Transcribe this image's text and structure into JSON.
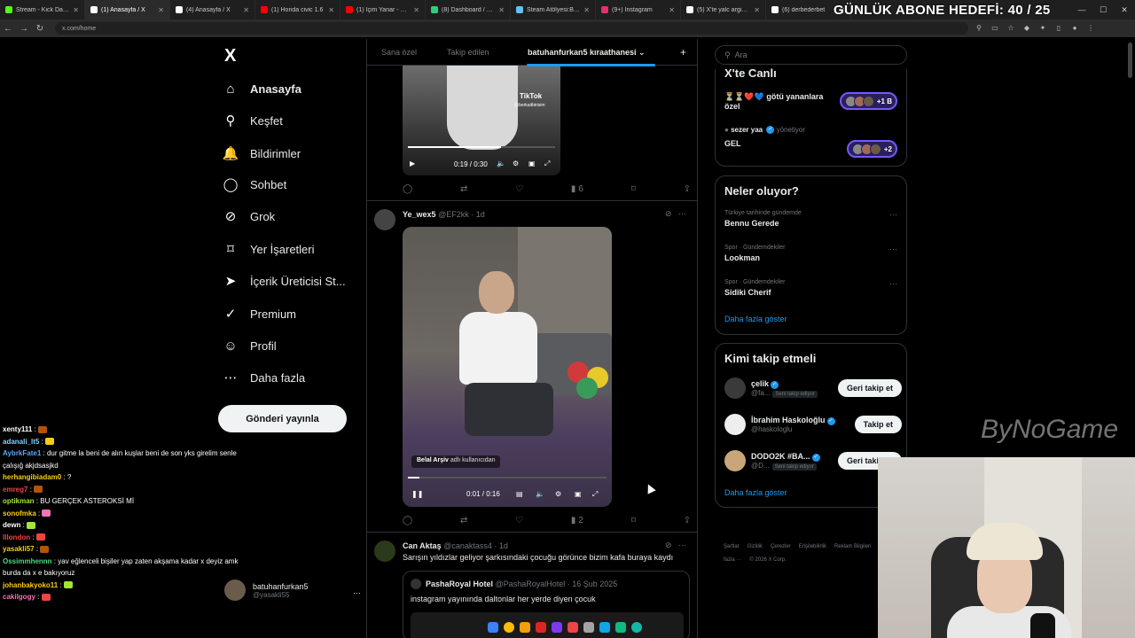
{
  "browser": {
    "tabs": [
      {
        "label": "Stream - Kick Dashboard",
        "color": "#53fc18"
      },
      {
        "label": "(1) Anasayfa / X",
        "color": "#ffffff"
      },
      {
        "label": "(4) Anasayfa / X",
        "color": "#ffffff"
      },
      {
        "label": "(1) Honda civic 1.6",
        "color": "#ff0000"
      },
      {
        "label": "(1) İçim Yanar - Şahin K",
        "color": "#ff0000"
      },
      {
        "label": "(8) Dashboard / Stream",
        "color": "#2ad17a"
      },
      {
        "label": "Steam Atölyesi:Batuha",
        "color": "#66c0f4"
      },
      {
        "label": "(9+) Instagram",
        "color": "#e1306c"
      },
      {
        "label": "(5) X'te yalc argisi \"de",
        "color": "#ffffff"
      },
      {
        "label": "(6) derbederbet",
        "color": "#ffffff"
      }
    ],
    "url": "x.com/home",
    "overlay_goal": "GÜNLÜK ABONE HEDEFİ: 40 / 25"
  },
  "nav": {
    "logo": "X",
    "items": [
      {
        "label": "Anasayfa",
        "icon": "home-icon",
        "glyph": "⌂"
      },
      {
        "label": "Keşfet",
        "icon": "search-icon",
        "glyph": "⚲"
      },
      {
        "label": "Bildirimler",
        "icon": "bell-icon",
        "glyph": "🔔"
      },
      {
        "label": "Sohbet",
        "icon": "chat-bubble-icon",
        "glyph": "◯"
      },
      {
        "label": "Grok",
        "icon": "grok-icon",
        "glyph": "⊘"
      },
      {
        "label": "Yer İşaretleri",
        "icon": "bookmark-icon",
        "glyph": "⌑"
      },
      {
        "label": "İçerik Üreticisi St...",
        "icon": "rocket-icon",
        "glyph": "➤"
      },
      {
        "label": "Premium",
        "icon": "premium-check-icon",
        "glyph": "✓"
      },
      {
        "label": "Profil",
        "icon": "person-icon",
        "glyph": "☺"
      },
      {
        "label": "Daha fazla",
        "icon": "more-circle-icon",
        "glyph": "⋯"
      }
    ],
    "post_button": "Gönderi yayınla",
    "profile": {
      "name": "batuhanfurkan5",
      "handle": "@yasakli55",
      "more": "···"
    }
  },
  "feed": {
    "tabs": [
      "Sana özel",
      "Takip edilen",
      "batuhanfurkan5 kıraathanesi ⌄"
    ],
    "plus": "+",
    "post1": {
      "video_time": "0:19 / 0:30",
      "tiktok_label": "TikTok",
      "tiktok_handle": "@berkaitbirisim",
      "progress": 0.63,
      "views": "6"
    },
    "post2": {
      "name": "Ye_wex5",
      "handle": "@EF2kk",
      "time": "· 1d",
      "video_time": "0:01 / 0:16",
      "credit_name": "Belal Arşiv",
      "credit_suffix": "adlı kullanıcıdan",
      "progress": 0.06,
      "views": "2"
    },
    "post3": {
      "name": "Can Aktaş",
      "handle": "@canaktass4",
      "time": "· 1d",
      "text": "Sarışın yıldızlar geliyor şarkısındaki çocuğu görünce bizim kafa buraya kaydı",
      "quote": {
        "name": "PashaRoyal Hotel",
        "handle": "@PashaRoyalHotel",
        "time": "· 16 Şub 2025",
        "text": "instagram yayınında daltonlar her yerde diyen çocuk"
      }
    }
  },
  "right": {
    "search_placeholder": "Ara",
    "live": {
      "title": "X'te Canlı",
      "items": [
        {
          "title": "⏳⏳❤️💙 götü yananlara özel",
          "count": "+1 B"
        },
        {
          "host": "sezer yaa",
          "role": "yönetiyor",
          "title": "GEL",
          "count": "+2"
        }
      ]
    },
    "trends": {
      "title": "Neler oluyor?",
      "items": [
        {
          "context": "Türkiye tarihinde gündemde",
          "name": "Bennu Gerede"
        },
        {
          "context": "Spor · Gündemdekiler",
          "name": "Lookman"
        },
        {
          "context": "Spor · Gündemdekiler",
          "name": "Sidiki Cherif"
        }
      ],
      "more": "Daha fazla göster"
    },
    "follow": {
      "title": "Kimi takip etmeli",
      "items": [
        {
          "name": "çelik",
          "handle": "@fa...",
          "badge": "Seni takip ediyor",
          "button": "Geri takip et"
        },
        {
          "name": "İbrahim Haskoloğlu",
          "handle": "@haskologlu",
          "badge": "",
          "button": "Takip et"
        },
        {
          "name": "DODO2K #BA...",
          "handle": "@D...",
          "badge": "Seni takip ediyor",
          "button": "Geri takip et"
        }
      ],
      "more": "Daha fazla göster"
    },
    "footer": [
      "Şartlar",
      "Gizlilik",
      "Çerezler",
      "Erişilebilirlik",
      "Reklam Bilgileri",
      "Daha fazla ···",
      "© 2026 X Corp."
    ]
  },
  "chat": [
    {
      "user": "xenty111",
      "color": "#ffffff",
      "text": ""
    },
    {
      "user": "adanali_lt5",
      "color": "#7dd3fc",
      "text": ""
    },
    {
      "user": "AybrkFate1",
      "color": "#60a5fa",
      "text": "dur gitme la beni de alın kuşlar beni de son yks girelim senle"
    },
    {
      "user": "",
      "color": "#ffffff",
      "text": "çalışığ akjdsasjkd"
    },
    {
      "user": "herhangibiadam0",
      "color": "#facc15",
      "text": "?"
    },
    {
      "user": "emreg7",
      "color": "#ef4444",
      "text": ""
    },
    {
      "user": "optikman",
      "color": "#a3e635",
      "text": "BU GERÇEK ASTEROKSİ Mİ"
    },
    {
      "user": "sonofmka",
      "color": "#facc15",
      "text": ""
    },
    {
      "user": "dewn",
      "color": "#ffffff",
      "text": ""
    },
    {
      "user": "lllondon",
      "color": "#ef4444",
      "text": ""
    },
    {
      "user": "yasakli57",
      "color": "#facc15",
      "text": ""
    },
    {
      "user": "Ossimmhennn",
      "color": "#4ade80",
      "text": "yav eğlenceli bişiler yap zaten akşama kadar x deyiz amk"
    },
    {
      "user": "",
      "color": "#ffffff",
      "text": "burda da x e bakıyoruz"
    },
    {
      "user": "johanbakyoko11",
      "color": "#facc15",
      "text": ""
    },
    {
      "user": "cakilgogy",
      "color": "#f472b6",
      "text": ""
    }
  ],
  "watermark": "ByNoGame"
}
